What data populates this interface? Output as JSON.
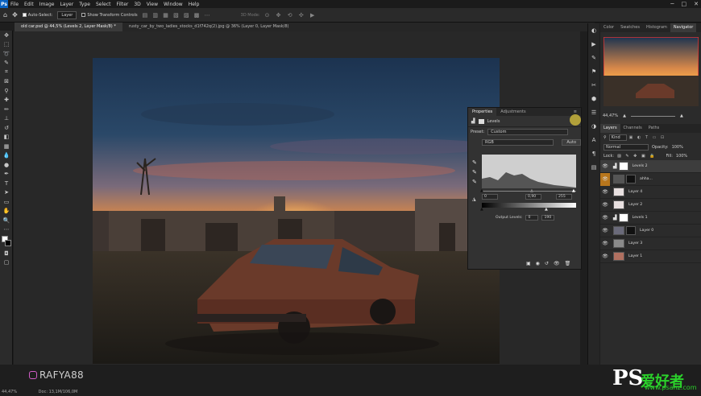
{
  "menu": [
    "File",
    "Edit",
    "Image",
    "Layer",
    "Type",
    "Select",
    "Filter",
    "3D",
    "View",
    "Window",
    "Help"
  ],
  "options": {
    "auto_select": "Auto-Select:",
    "layer_dropdown": "Layer",
    "transform": "Show Transform Controls",
    "mode3d": "3D Mode:"
  },
  "tabs": [
    "old car.psd @ 44,5% (Levels 2, Layer Mask/8) *",
    "rusty_car_by_two_ladies_stocks_d1f742q(2).jpg @ 36% (Layer 0, Layer Mask/8)"
  ],
  "properties": {
    "tab1": "Properties",
    "tab2": "Adjustments",
    "title": "Levels",
    "preset_label": "Preset:",
    "preset_value": "Custom",
    "channel": "RGB",
    "auto": "Auto",
    "input_black": "0",
    "input_mid": "0,90",
    "input_white": "255",
    "output_label": "Output Levels:",
    "output_black": "0",
    "output_white": "190"
  },
  "right_panel": {
    "top_tabs": [
      "Color",
      "Swatches",
      "Histogram",
      "Navigator"
    ],
    "zoom": "44,47%",
    "layer_tabs": [
      "Layers",
      "Channels",
      "Paths"
    ],
    "kind": "Kind",
    "blend": "Normal",
    "opacity_label": "Opacity:",
    "opacity": "100%",
    "lock_label": "Lock:",
    "fill_label": "Fill:",
    "fill": "100%",
    "layers": [
      "Levels 2",
      "ahha...",
      "Layer 4",
      "Layer 2",
      "Levels 1",
      "Layer 0",
      "Layer 3",
      "Layer 1"
    ]
  },
  "status": {
    "zoom": "44,47%",
    "doc": "Doc: 13,1M/106,0M"
  },
  "watermark": "RAFYA88",
  "site": {
    "logo": "PS",
    "cn": "爱好者",
    "url": "www.psahz.com"
  }
}
